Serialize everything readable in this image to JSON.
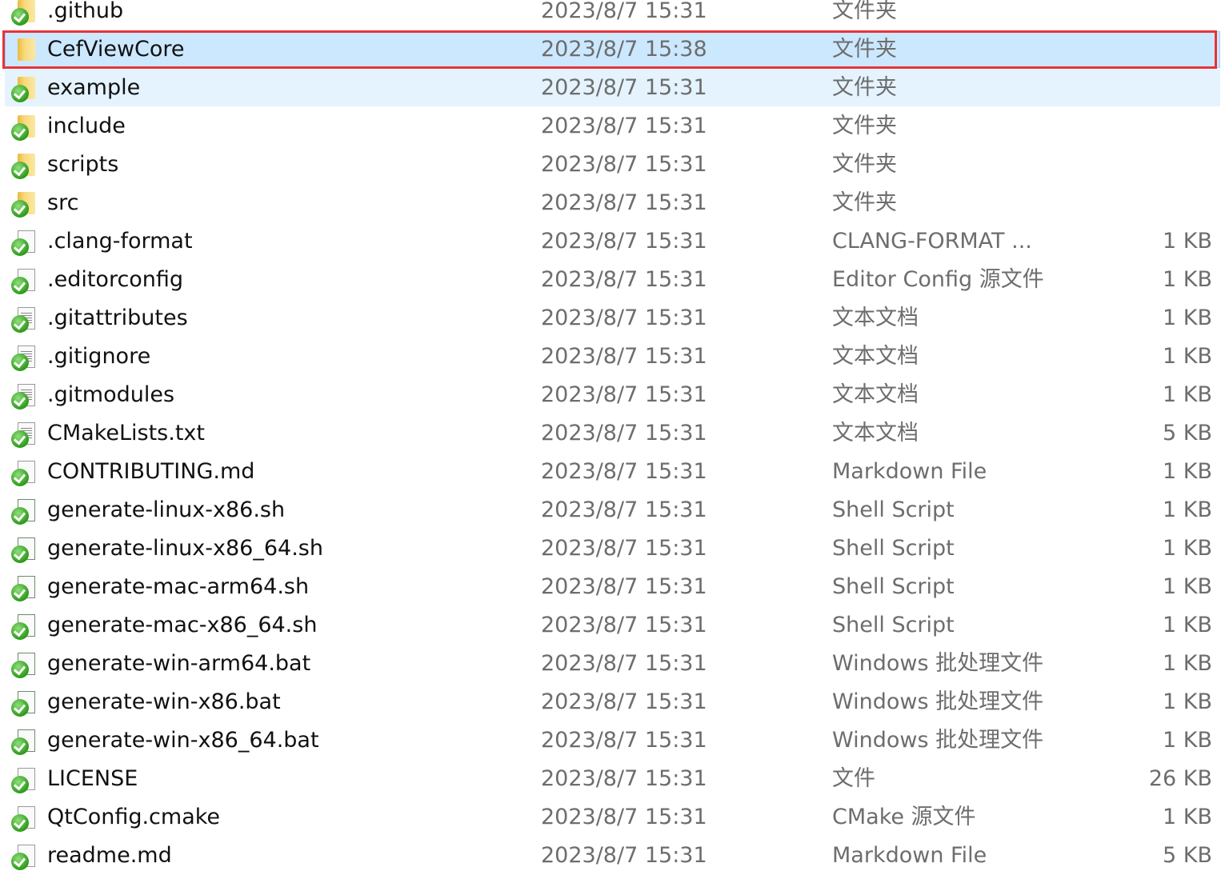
{
  "files": [
    {
      "name": ".github",
      "date": "2023/8/7 15:31",
      "type": "文件夹",
      "size": "",
      "icon": "folder",
      "synced": true,
      "state": ""
    },
    {
      "name": "CefViewCore",
      "date": "2023/8/7 15:38",
      "type": "文件夹",
      "size": "",
      "icon": "folder",
      "synced": false,
      "state": "selected"
    },
    {
      "name": "example",
      "date": "2023/8/7 15:31",
      "type": "文件夹",
      "size": "",
      "icon": "folder",
      "synced": true,
      "state": "hover"
    },
    {
      "name": "include",
      "date": "2023/8/7 15:31",
      "type": "文件夹",
      "size": "",
      "icon": "folder",
      "synced": true,
      "state": ""
    },
    {
      "name": "scripts",
      "date": "2023/8/7 15:31",
      "type": "文件夹",
      "size": "",
      "icon": "folder",
      "synced": true,
      "state": ""
    },
    {
      "name": "src",
      "date": "2023/8/7 15:31",
      "type": "文件夹",
      "size": "",
      "icon": "folder",
      "synced": true,
      "state": ""
    },
    {
      "name": ".clang-format",
      "date": "2023/8/7 15:31",
      "type": "CLANG-FORMAT ...",
      "size": "1 KB",
      "icon": "file",
      "synced": true,
      "state": ""
    },
    {
      "name": ".editorconfig",
      "date": "2023/8/7 15:31",
      "type": "Editor Config 源文件",
      "size": "1 KB",
      "icon": "file",
      "synced": true,
      "state": ""
    },
    {
      "name": ".gitattributes",
      "date": "2023/8/7 15:31",
      "type": "文本文档",
      "size": "1 KB",
      "icon": "txt",
      "synced": true,
      "state": ""
    },
    {
      "name": ".gitignore",
      "date": "2023/8/7 15:31",
      "type": "文本文档",
      "size": "1 KB",
      "icon": "txt",
      "synced": true,
      "state": ""
    },
    {
      "name": ".gitmodules",
      "date": "2023/8/7 15:31",
      "type": "文本文档",
      "size": "1 KB",
      "icon": "txt",
      "synced": true,
      "state": ""
    },
    {
      "name": "CMakeLists.txt",
      "date": "2023/8/7 15:31",
      "type": "文本文档",
      "size": "5 KB",
      "icon": "txt",
      "synced": true,
      "state": ""
    },
    {
      "name": "CONTRIBUTING.md",
      "date": "2023/8/7 15:31",
      "type": "Markdown File",
      "size": "1 KB",
      "icon": "file",
      "synced": true,
      "state": ""
    },
    {
      "name": "generate-linux-x86.sh",
      "date": "2023/8/7 15:31",
      "type": "Shell Script",
      "size": "1 KB",
      "icon": "script",
      "synced": true,
      "state": ""
    },
    {
      "name": "generate-linux-x86_64.sh",
      "date": "2023/8/7 15:31",
      "type": "Shell Script",
      "size": "1 KB",
      "icon": "script",
      "synced": true,
      "state": ""
    },
    {
      "name": "generate-mac-arm64.sh",
      "date": "2023/8/7 15:31",
      "type": "Shell Script",
      "size": "1 KB",
      "icon": "script",
      "synced": true,
      "state": ""
    },
    {
      "name": "generate-mac-x86_64.sh",
      "date": "2023/8/7 15:31",
      "type": "Shell Script",
      "size": "1 KB",
      "icon": "script",
      "synced": true,
      "state": ""
    },
    {
      "name": "generate-win-arm64.bat",
      "date": "2023/8/7 15:31",
      "type": "Windows 批处理文件",
      "size": "1 KB",
      "icon": "script",
      "synced": true,
      "state": ""
    },
    {
      "name": "generate-win-x86.bat",
      "date": "2023/8/7 15:31",
      "type": "Windows 批处理文件",
      "size": "1 KB",
      "icon": "script",
      "synced": true,
      "state": ""
    },
    {
      "name": "generate-win-x86_64.bat",
      "date": "2023/8/7 15:31",
      "type": "Windows 批处理文件",
      "size": "1 KB",
      "icon": "script",
      "synced": true,
      "state": ""
    },
    {
      "name": "LICENSE",
      "date": "2023/8/7 15:31",
      "type": "文件",
      "size": "26 KB",
      "icon": "file",
      "synced": true,
      "state": ""
    },
    {
      "name": "QtConfig.cmake",
      "date": "2023/8/7 15:31",
      "type": "CMake 源文件",
      "size": "1 KB",
      "icon": "file",
      "synced": true,
      "state": ""
    },
    {
      "name": "readme.md",
      "date": "2023/8/7 15:31",
      "type": "Markdown File",
      "size": "5 KB",
      "icon": "file",
      "synced": true,
      "state": ""
    }
  ],
  "colors": {
    "selected_bg": "#cce8ff",
    "hover_bg": "#e5f3ff",
    "highlight_border": "#e8323a",
    "sync_check": "#2e9a1c"
  }
}
